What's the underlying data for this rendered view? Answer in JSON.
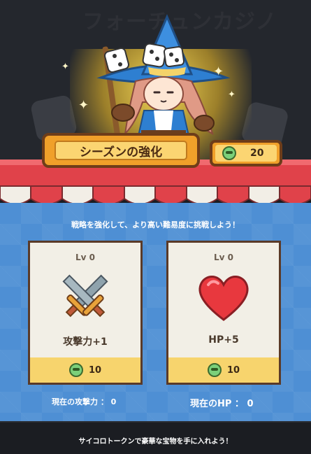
{
  "header": {
    "casino_title": "フォーチュンカジノ"
  },
  "season": {
    "title": "シーズンの強化",
    "tokens": "20"
  },
  "subtitle": "戦略を強化して、より高い難易度に挑戦しよう！",
  "cards": [
    {
      "level": "Lv 0",
      "name": "攻撃力+1",
      "cost": "10",
      "icon": "crossed-swords-icon"
    },
    {
      "level": "Lv 0",
      "name": "HP+5",
      "cost": "10",
      "icon": "heart-icon"
    }
  ],
  "stats": {
    "attack": "現在の攻撃力 ： 0",
    "hp": "現在のHP ： 0"
  },
  "footer": {
    "text": "サイコロトークンで豪華な宝物を手に入れよう！"
  },
  "colors": {
    "main_blue": "#4e8fd4",
    "banner_orange": "#f0a02a",
    "banner_yellow": "#fbd572",
    "awning_red": "#e0424a",
    "card_bg": "#f2efe6"
  }
}
